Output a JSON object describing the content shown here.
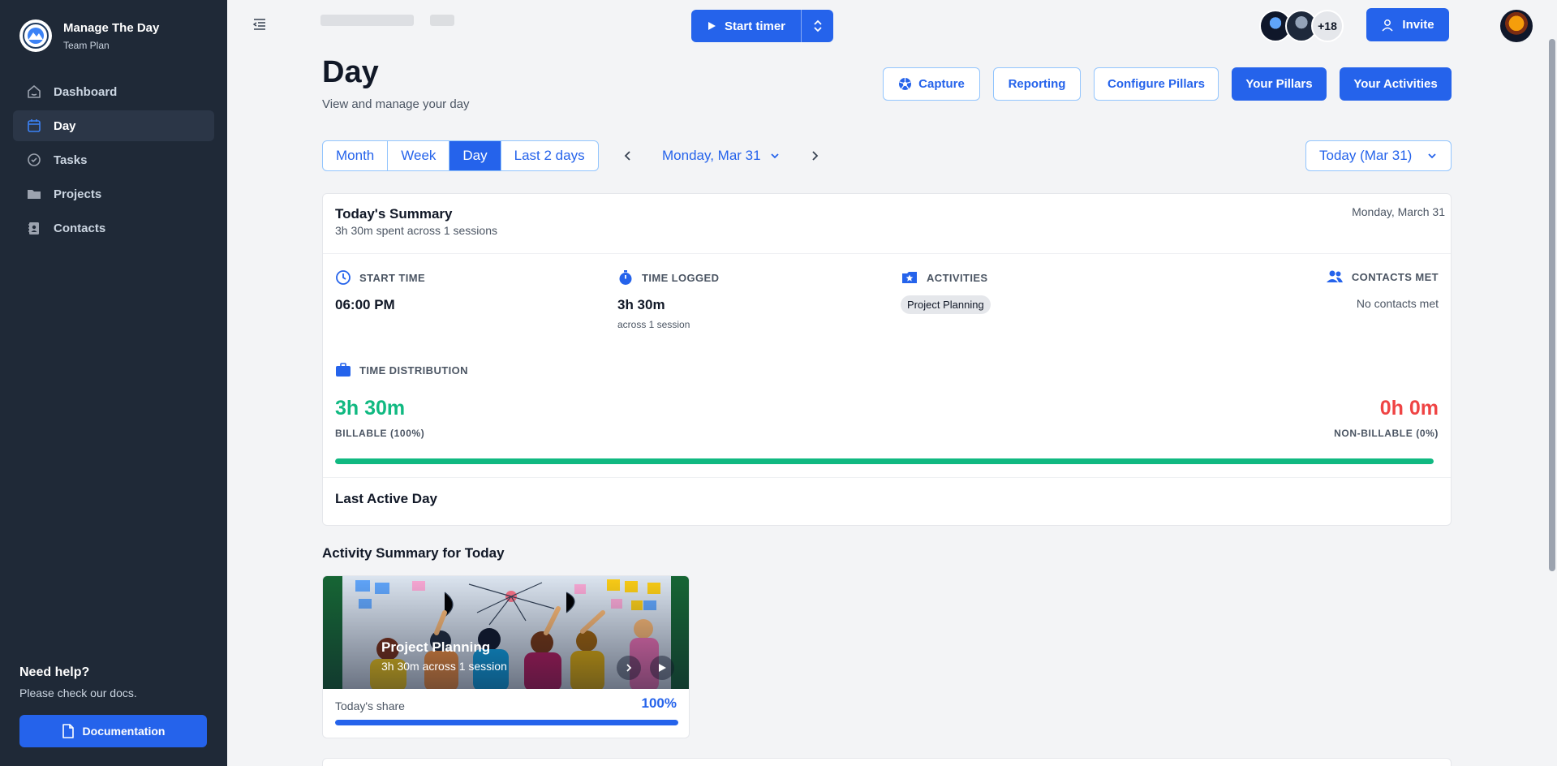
{
  "app": {
    "name": "Manage The Day",
    "plan": "Team Plan"
  },
  "sidebar": {
    "items": [
      {
        "label": "Dashboard",
        "icon": "home-icon"
      },
      {
        "label": "Day",
        "icon": "calendar-icon",
        "active": true
      },
      {
        "label": "Tasks",
        "icon": "check-circle-icon"
      },
      {
        "label": "Projects",
        "icon": "folder-icon"
      },
      {
        "label": "Contacts",
        "icon": "contact-card-icon"
      }
    ],
    "help": {
      "title": "Need help?",
      "text": "Please check our docs.",
      "button": "Documentation"
    }
  },
  "topbar": {
    "timer_label": "Start timer",
    "avatars_more": "+18",
    "invite_label": "Invite"
  },
  "header": {
    "title": "Day",
    "subtitle": "View and manage your day",
    "buttons": {
      "capture": "Capture",
      "reporting": "Reporting",
      "configure_pillars": "Configure Pillars",
      "your_pillars": "Your Pillars",
      "your_activities": "Your Activities"
    }
  },
  "view": {
    "tabs": [
      "Month",
      "Week",
      "Day",
      "Last 2 days"
    ],
    "active_tab": "Day",
    "current_date": "Monday, Mar 31",
    "today_select": "Today (Mar 31)"
  },
  "summary": {
    "title": "Today's Summary",
    "subtitle": "3h 30m spent across 1 sessions",
    "date": "Monday, March 31",
    "start_time": {
      "label": "START TIME",
      "value": "06:00 PM"
    },
    "time_logged": {
      "label": "TIME LOGGED",
      "value": "3h 30m",
      "note": "across 1 session"
    },
    "activities": {
      "label": "ACTIVITIES",
      "chip": "Project Planning"
    },
    "contacts": {
      "label": "CONTACTS MET",
      "value": "No contacts met"
    },
    "distribution": {
      "label": "TIME DISTRIBUTION",
      "billable_value": "3h 30m",
      "billable_label": "BILLABLE (100%)",
      "nonbillable_value": "0h 0m",
      "nonbillable_label": "NON-BILLABLE (0%)",
      "billable_fraction": 1.0
    },
    "last_active": "Last Active Day"
  },
  "activity_summary": {
    "title": "Activity Summary for Today",
    "cards": [
      {
        "name": "Project Planning",
        "meta": "3h 30m across 1 session",
        "share_label": "Today's share",
        "share_value": "100%",
        "share_fraction": 1.0
      }
    ]
  },
  "colors": {
    "primary": "#2563eb",
    "sidebar": "#1f2937",
    "billable": "#10b981",
    "nonbillable": "#ef4444"
  }
}
